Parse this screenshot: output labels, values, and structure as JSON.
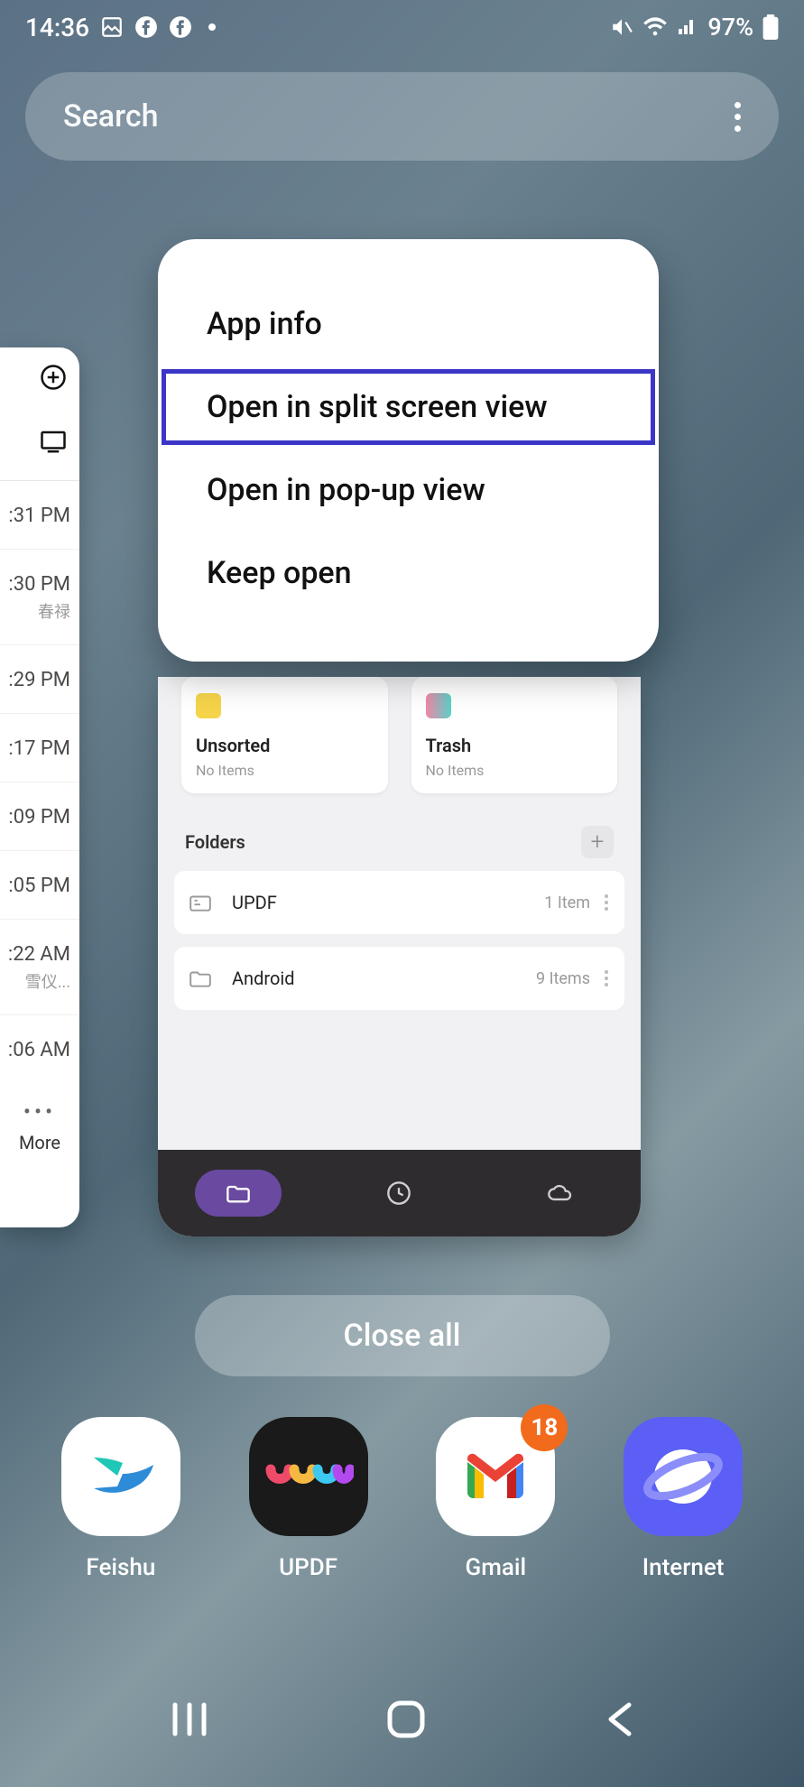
{
  "status": {
    "time": "14:36",
    "battery": "97%"
  },
  "search": {
    "placeholder": "Search"
  },
  "side": {
    "items": [
      {
        "time": ":31 PM"
      },
      {
        "time": ":30 PM",
        "sub": "春禄"
      },
      {
        "time": ":29 PM"
      },
      {
        "time": ":17 PM"
      },
      {
        "time": ":09 PM"
      },
      {
        "time": ":05 PM"
      },
      {
        "time": ":22 AM",
        "sub": "雪仪..."
      },
      {
        "time": ":06 AM"
      }
    ],
    "more": "More"
  },
  "app_preview": {
    "categories": [
      {
        "label": "Unsorted",
        "sub": "No Items"
      },
      {
        "label": "Trash",
        "sub": "No Items"
      }
    ],
    "folders_header": "Folders",
    "folders": [
      {
        "name": "UPDF",
        "count": "1 Item"
      },
      {
        "name": "Android",
        "count": "9 Items"
      }
    ]
  },
  "context_menu": {
    "items": [
      {
        "label": "App info"
      },
      {
        "label": "Open in split screen view",
        "highlight": true
      },
      {
        "label": "Open in pop-up view"
      },
      {
        "label": "Keep open"
      }
    ]
  },
  "close_all": "Close all",
  "dock": {
    "items": [
      {
        "label": "Feishu"
      },
      {
        "label": "UPDF"
      },
      {
        "label": "Gmail",
        "badge": "18"
      },
      {
        "label": "Internet"
      }
    ]
  }
}
